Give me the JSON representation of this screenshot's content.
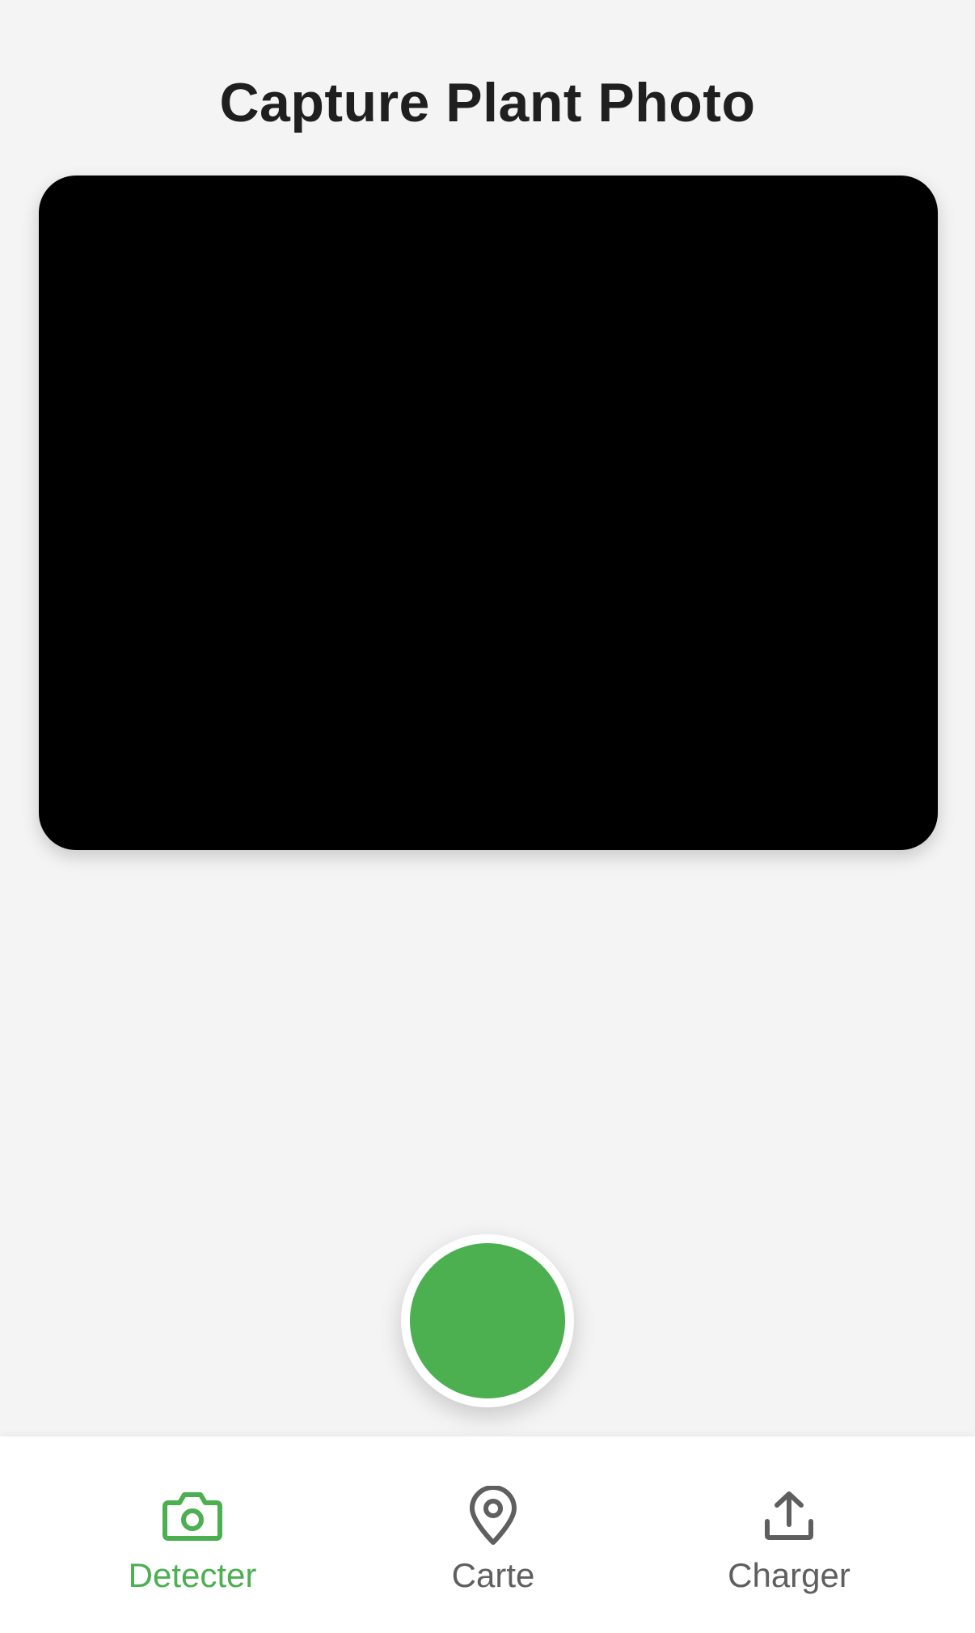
{
  "header": {
    "title": "Capture Plant Photo"
  },
  "camera": {
    "shutter_color": "#4caf50"
  },
  "tabbar": {
    "active_color": "#4caf50",
    "inactive_color": "#5f5f5f",
    "tabs": [
      {
        "label": "Detecter",
        "icon": "camera-icon",
        "active": true
      },
      {
        "label": "Carte",
        "icon": "map-pin-icon",
        "active": false
      },
      {
        "label": "Charger",
        "icon": "upload-icon",
        "active": false
      }
    ]
  }
}
